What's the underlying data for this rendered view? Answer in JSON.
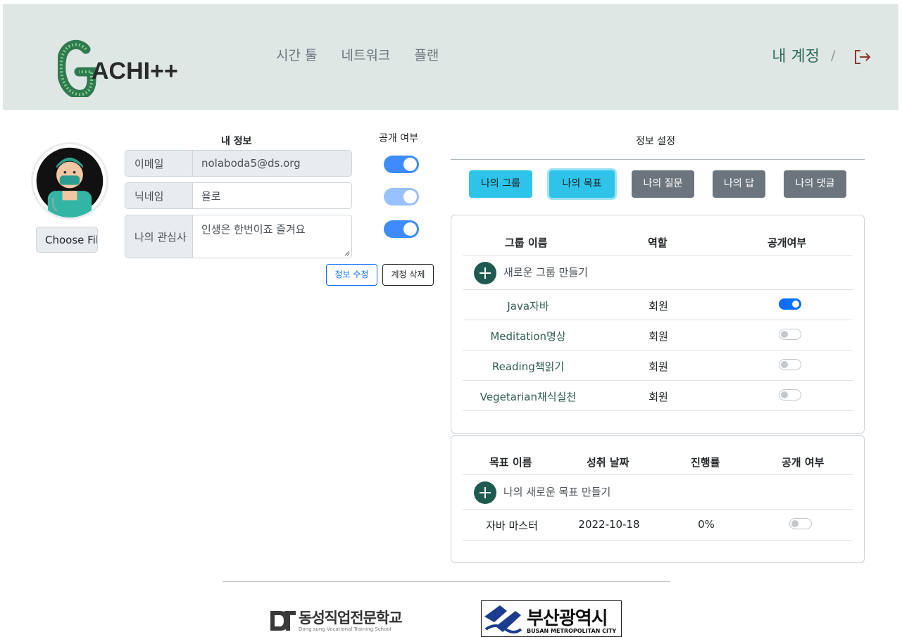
{
  "header": {
    "logo_text": "GACHI++",
    "nav": [
      "시간 툴",
      "네트워크",
      "플랜"
    ],
    "account": "내 계정",
    "separator": "/"
  },
  "profile": {
    "choose_file": "Choose File",
    "my_info_title": "내 정보",
    "public_title": "공개 여부",
    "fields": [
      {
        "label": "이메일",
        "value": "nolaboda5@ds.org"
      },
      {
        "label": "닉네임",
        "value": "욜로"
      },
      {
        "label": "나의 관심사",
        "value": "인생은 한번이죠 즐겨요"
      }
    ],
    "edit_button": "정보 수정",
    "delete_button": "계정 삭제"
  },
  "settings": {
    "title": "정보 설정",
    "tabs": [
      "나의 그룹",
      "나의 목표",
      "나의 질문",
      "나의 답",
      "나의 댓글"
    ]
  },
  "groups": {
    "headers": [
      "그룹 이름",
      "역할",
      "공개여부"
    ],
    "create_text": "새로운 그룹 만들기",
    "rows": [
      {
        "name": "Java자바",
        "role": "회원",
        "public": true
      },
      {
        "name": "Meditation명상",
        "role": "회원",
        "public": false
      },
      {
        "name": "Reading책읽기",
        "role": "회원",
        "public": false
      },
      {
        "name": "Vegetarian채식실천",
        "role": "회원",
        "public": false
      }
    ]
  },
  "goals": {
    "headers": [
      "목표 이름",
      "성취 날짜",
      "진행률",
      "공개 여부"
    ],
    "create_text": "나의 새로운 목표 만들기",
    "rows": [
      {
        "name": "자바 마스터",
        "date": "2022-10-18",
        "progress": "0%",
        "public": false
      }
    ]
  },
  "footer": {
    "ds_name": "동성직업전문학교",
    "ds_sub": "Dong sung Vocational Training School",
    "busan_name": "부산광역시",
    "busan_sub": "BUSAN METROPOLITAN CITY"
  },
  "colors": {
    "header_bg": "#dfe7e5",
    "accent_cyan": "#2ec4ea",
    "toggle_blue": "#0d6efd",
    "plus_green": "#1f5a50"
  }
}
